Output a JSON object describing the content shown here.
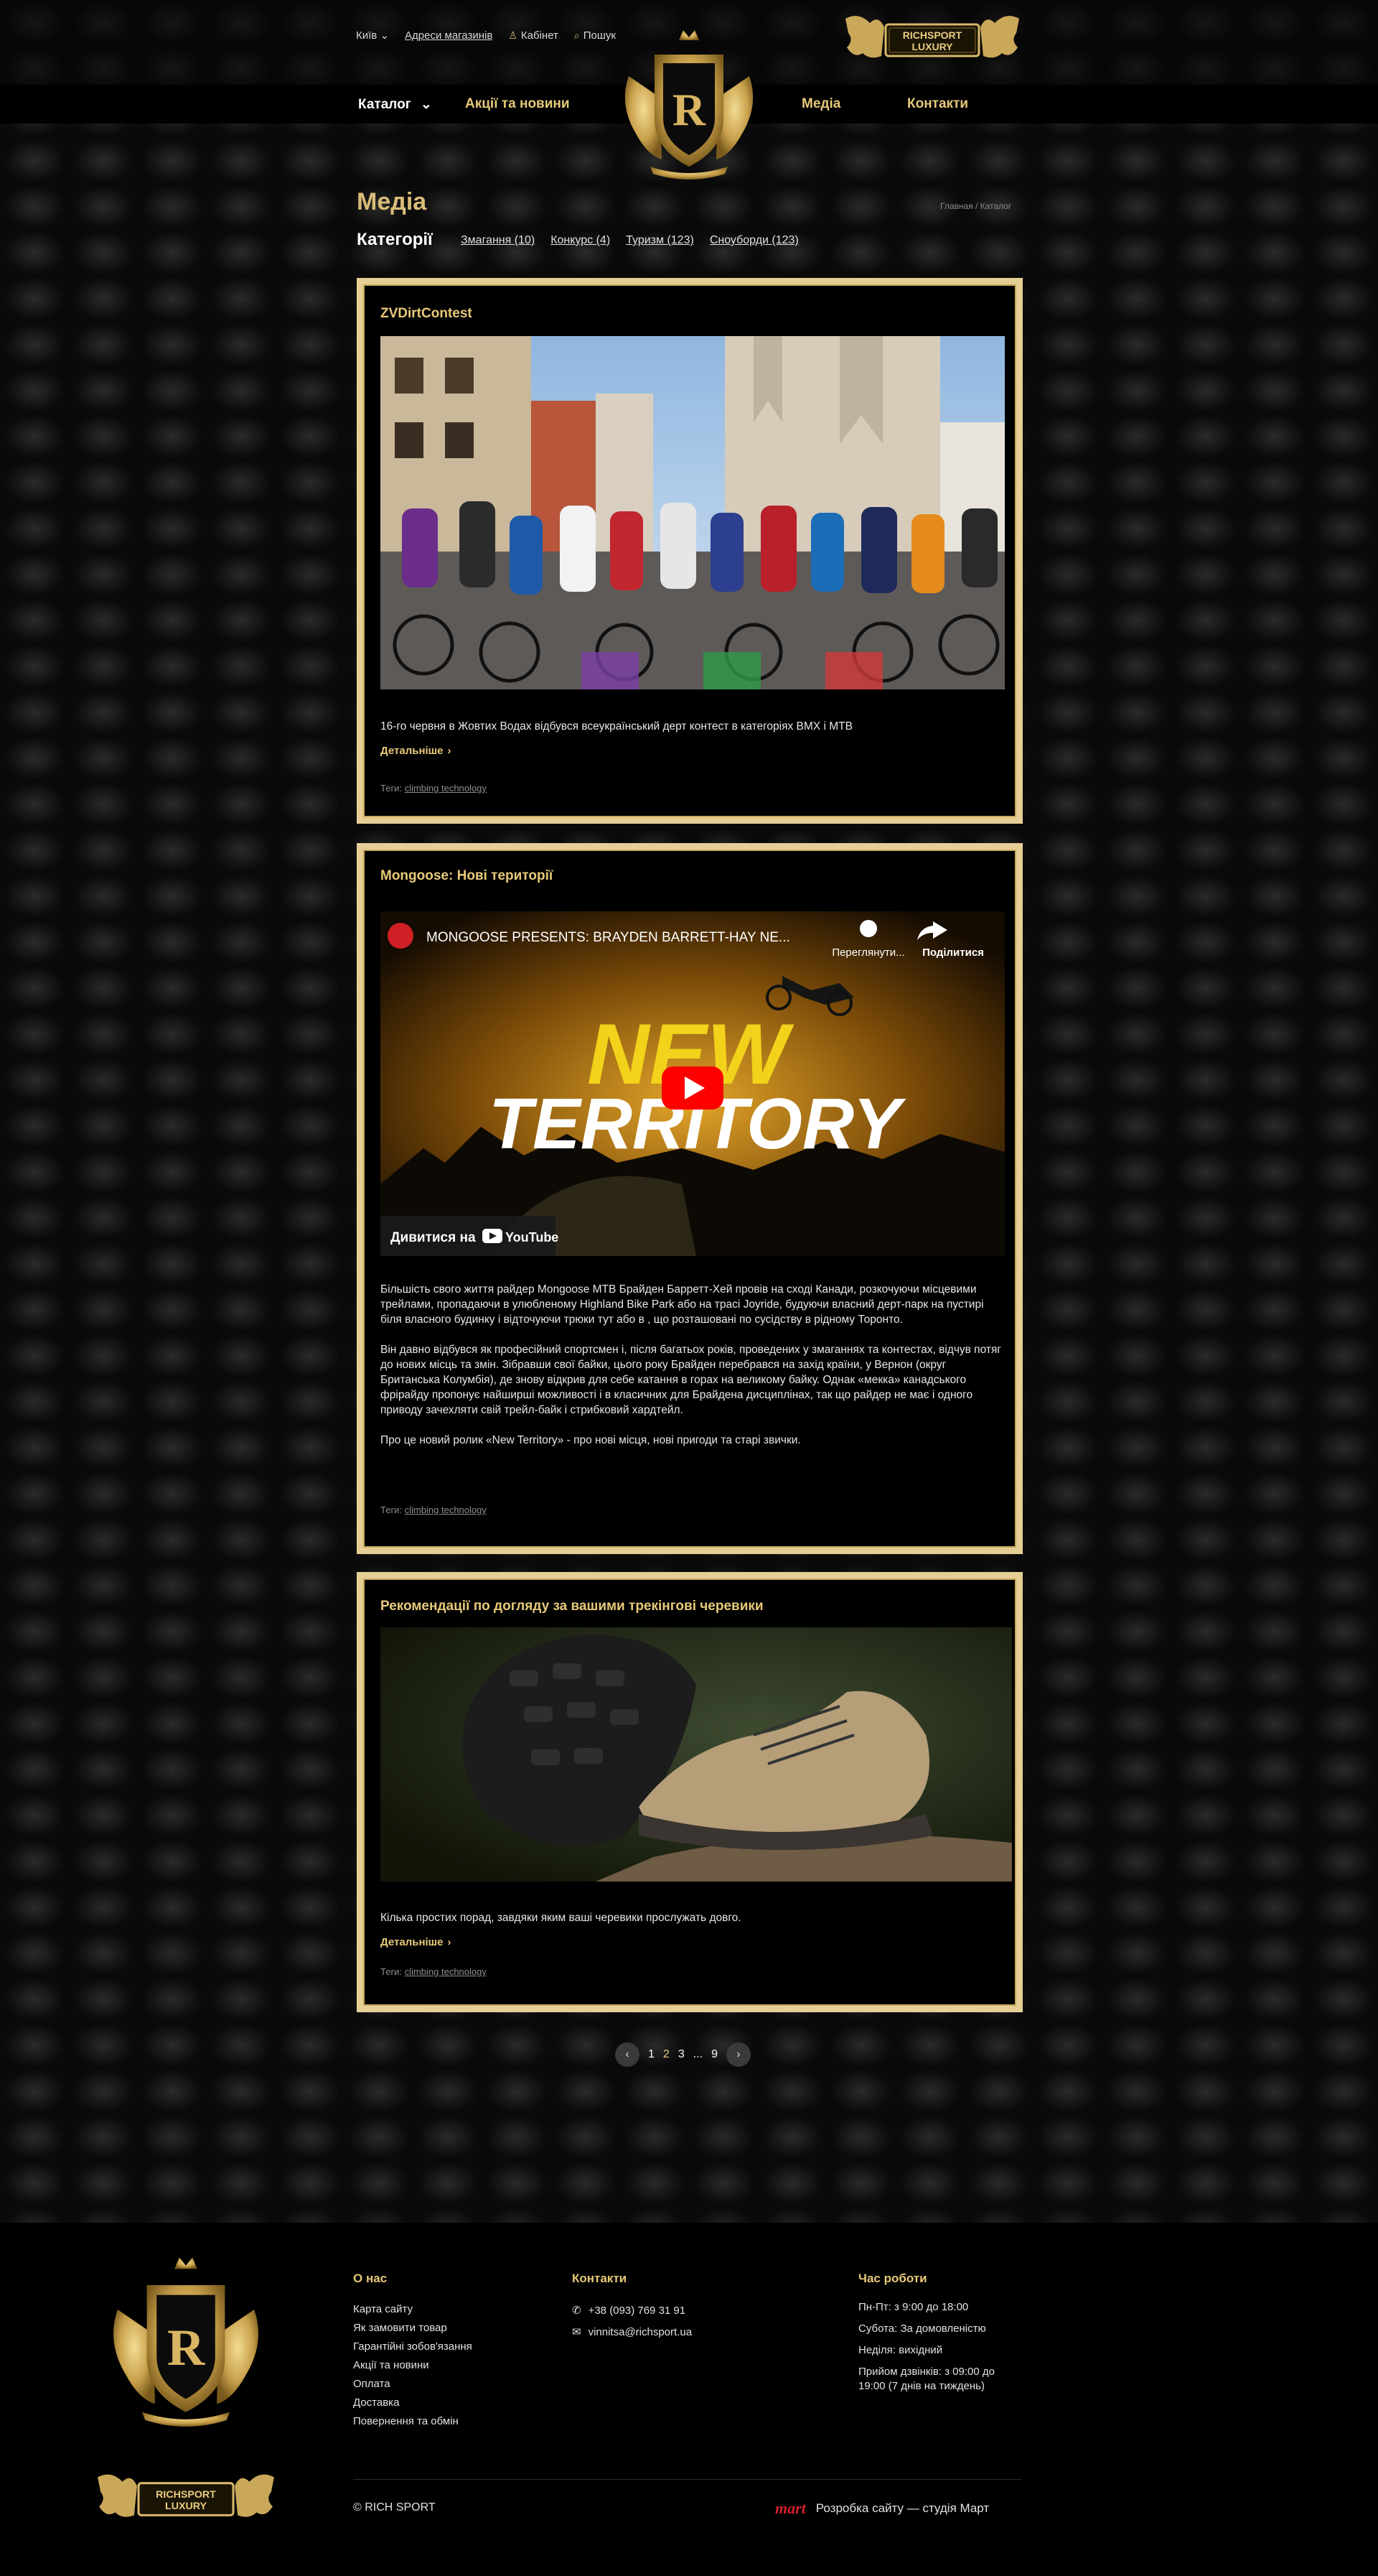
{
  "topbar": {
    "city": "Київ",
    "stores": "Адреси магазинів",
    "account": "Кабінет",
    "search": "Пошук"
  },
  "brand": {
    "name_line1": "RICHSPORT",
    "name_line2": "LUXURY",
    "monogram": "R"
  },
  "nav": {
    "catalog": "Каталог",
    "promos": "Акції та новини",
    "media": "Медіа",
    "contacts": "Контакти"
  },
  "page": {
    "title": "Медіа",
    "breadcrumbs": "Главная / Каталог",
    "categories_title": "Категорії",
    "categories": [
      "Змагання (10)",
      "Конкурс (4)",
      "Туризм (123)",
      "Сноуборди (123)"
    ]
  },
  "articles": [
    {
      "title": "ZVDirtContest",
      "text": [
        "16-го червня в Жовтих Водах відбувся всеукраїнський дерт контест в категоріях BMX і MTB"
      ],
      "more": "Детальніше",
      "tags_label": "Теги:",
      "tag": "climbing technology"
    },
    {
      "title": "Mongoose: Нові території",
      "video": {
        "channel_title": "MONGOOSE PRESENTS: BRAYDEN BARRETT-HAY NE...",
        "watch_later": "Переглянути...",
        "share": "Поділитися",
        "headline_1": "NEW",
        "headline_2": "TERRITORY",
        "watch_on": "Дивитися на",
        "youtube": "YouTube"
      },
      "text": [
        "Більшість свого життя райдер Mongoose MTB Брайден Барретт-Хей провів на сході Канади, розкочуючи місцевими трейлами, пропадаючи в улюбленому Highland Bike Park або на трасі Joyride, будуючи власний дерт-парк на пустирі біля власного будинку і відточуючи трюки тут або в , що розташовані по сусідству в рідному Торонто.",
        "Він давно відбувся як професійний спортсмен і, після багатьох років, проведених у змаганнях та контестах, відчув потяг до нових місць та змін. Зібравши свої байки, цього року Брайден перебрався на захід країни, у Вернон (округ Британська Колумбія), де знову відкрив для себе катання в горах на великому байку. Однак «мекка» канадського фрірайду пропонує найширші можливості і в класичних для Брайдена дисциплінах, так що райдер не має і одного приводу зачехляти свій трейл-байк і стрибковий хардтейл.",
        "Про це новий ролик «New Territory» - про нові місця, нові пригоди та старі звички."
      ],
      "tags_label": "Теги:",
      "tag": "climbing technology"
    },
    {
      "title": "Рекомендації по догляду за вашими трекінгові черевики",
      "text": [
        "Кілька простих порад, завдяки яким ваші черевики прослужать довго."
      ],
      "more": "Детальніше",
      "tags_label": "Теги:",
      "tag": "climbing technology"
    }
  ],
  "pagination": {
    "prev": "‹",
    "pages": [
      "1",
      "2",
      "3",
      "...",
      "9"
    ],
    "active": "2",
    "next": "›"
  },
  "footer": {
    "about_title": "О нас",
    "about_links": [
      "Карта сайту",
      "Як замовити товар",
      "Гарантійні зобов'язання",
      "Акції та новини",
      "Оплата",
      "Доставка",
      "Повернення та обмін"
    ],
    "contacts_title": "Контакти",
    "phone": "+38 (093) 769 31 91",
    "email": "vinnitsa@richsport.ua",
    "hours_title": "Час роботи",
    "hours": [
      "Пн-Пт: з 9:00 до 18:00",
      "Субота: За домовленістю",
      "Неділя: вихідний",
      "Прийом дзвінків: з 09:00 до 19:00 (7 днів на тиждень)"
    ],
    "copyright": "© RICH SPORT",
    "studio_mark": "mart",
    "studio": "Розробка сайту — студія Март"
  },
  "colors": {
    "gold": "#e7c979",
    "gold_frame": "#e6cf96",
    "background": "#0b0b0b"
  }
}
